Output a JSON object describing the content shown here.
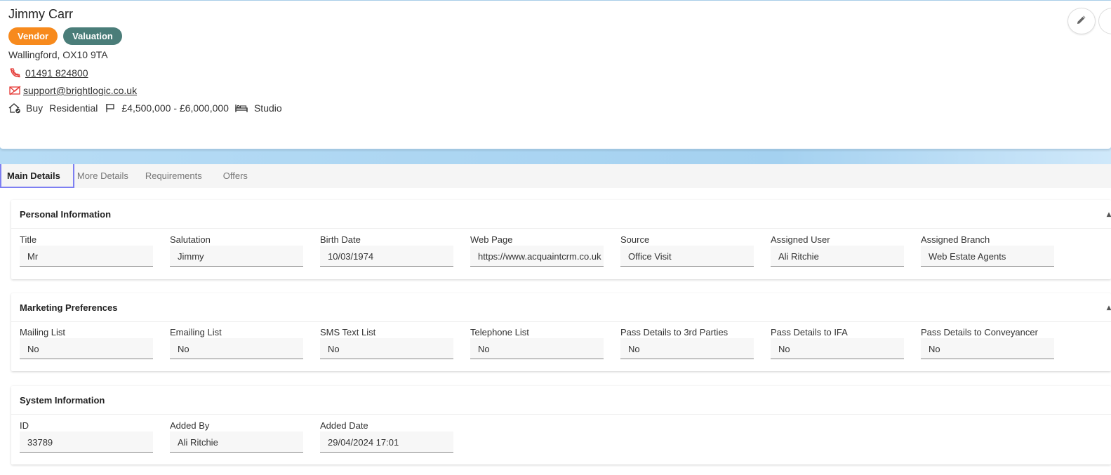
{
  "contact": {
    "name": "Jimmy Carr",
    "badges": [
      "Vendor",
      "Valuation"
    ],
    "address": "Wallingford, OX10 9TA",
    "phone": "01491 824800",
    "email": "support@brightlogic.co.uk",
    "requirement": {
      "type": "Buy",
      "category": "Residential",
      "price": "£4,500,000 - £6,000,000",
      "bedrooms": "Studio"
    }
  },
  "colors": {
    "vendor_badge": "#f78a1d",
    "valuation_badge": "#4a7d79",
    "active_tab_border": "#7d7ff2"
  },
  "tabs": [
    {
      "label": "Main Details",
      "active": true
    },
    {
      "label": "More Details",
      "active": false
    },
    {
      "label": "Requirements",
      "active": false
    },
    {
      "label": "Offers",
      "active": false
    }
  ],
  "sections": {
    "personal": {
      "title": "Personal Information",
      "fields": [
        {
          "label": "Title",
          "value": "Mr"
        },
        {
          "label": "Salutation",
          "value": "Jimmy"
        },
        {
          "label": "Birth Date",
          "value": "10/03/1974"
        },
        {
          "label": "Web Page",
          "value": "https://www.acquaintcrm.co.uk"
        },
        {
          "label": "Source",
          "value": "Office Visit"
        },
        {
          "label": "Assigned User",
          "value": "Ali Ritchie"
        },
        {
          "label": "Assigned Branch",
          "value": "Web Estate Agents"
        }
      ]
    },
    "marketing": {
      "title": "Marketing Preferences",
      "fields": [
        {
          "label": "Mailing List",
          "value": "No"
        },
        {
          "label": "Emailing List",
          "value": "No"
        },
        {
          "label": "SMS Text List",
          "value": "No"
        },
        {
          "label": "Telephone List",
          "value": "No"
        },
        {
          "label": "Pass Details to 3rd Parties",
          "value": "No"
        },
        {
          "label": "Pass Details to IFA",
          "value": "No"
        },
        {
          "label": "Pass Details to Conveyancer",
          "value": "No"
        }
      ]
    },
    "system": {
      "title": "System Information",
      "fields": [
        {
          "label": "ID",
          "value": "33789"
        },
        {
          "label": "Added By",
          "value": "Ali Ritchie"
        },
        {
          "label": "Added Date",
          "value": "29/04/2024 17:01"
        }
      ]
    }
  },
  "icons": {
    "phone": "phone-slash-icon",
    "email": "mail-slash-icon",
    "buy": "house-check-icon",
    "price": "flag-icon",
    "bed": "bed-icon",
    "edit": "pencil-icon"
  }
}
